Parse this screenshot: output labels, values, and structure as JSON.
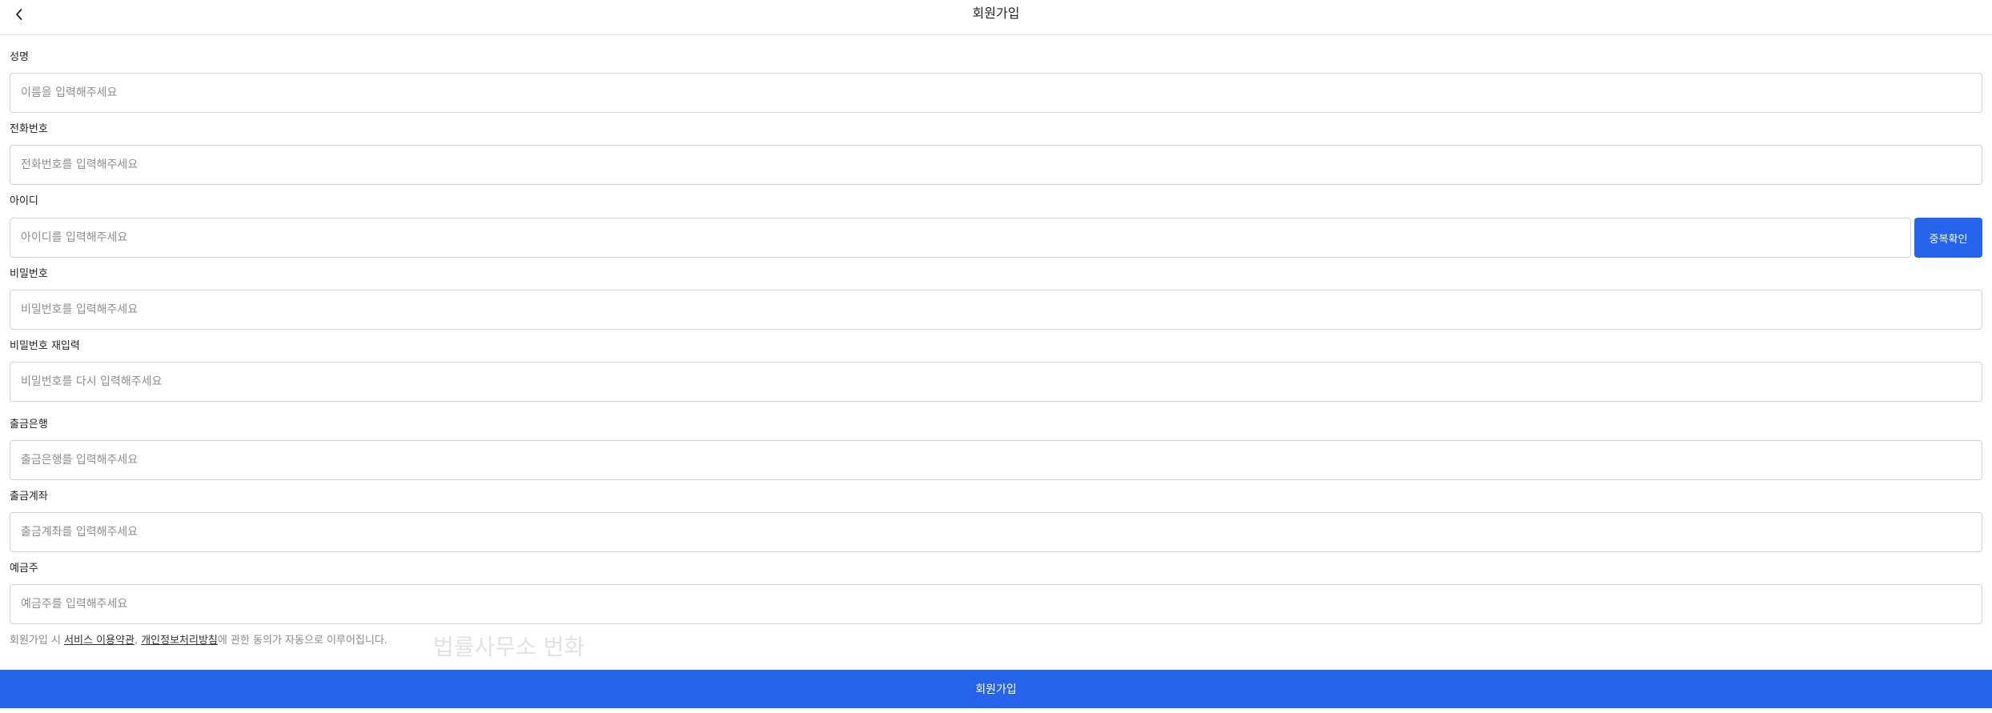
{
  "header": {
    "title": "회원가입",
    "back_icon": "chevron-left-icon"
  },
  "fields": {
    "name": {
      "label": "성명",
      "placeholder": "이름을 입력해주세요",
      "value": ""
    },
    "phone": {
      "label": "전화번호",
      "placeholder": "전화번호를 입력해주세요",
      "value": ""
    },
    "user_id": {
      "label": "아이디",
      "placeholder": "아이디를 입력해주세요",
      "value": "",
      "check_button": "중복확인"
    },
    "password": {
      "label": "비밀번호",
      "placeholder": "비밀번호를 입력해주세요",
      "value": ""
    },
    "password_confirm": {
      "label": "비밀번호 재입력",
      "placeholder": "비밀번호를 다시 입력해주세요",
      "value": ""
    },
    "bank": {
      "label": "출금은행",
      "placeholder": "출금은행를 입력해주세요",
      "value": ""
    },
    "account": {
      "label": "출금계좌",
      "placeholder": "출금계좌를 입력해주세요",
      "value": ""
    },
    "holder": {
      "label": "예금주",
      "placeholder": "예금주를 입력해주세요",
      "value": ""
    }
  },
  "agreement": {
    "prefix": "회원가입 시 ",
    "terms_link": "서비스 이용약관",
    "separator": ", ",
    "privacy_link": "개인정보처리방침",
    "suffix": "에 관한 동의가 자동으로 이루어집니다."
  },
  "watermark": "법률사무소 번화",
  "submit_button": "회원가입",
  "colors": {
    "accent": "#2563eb",
    "border": "#d4d4d4",
    "placeholder": "#8e8e8e"
  }
}
